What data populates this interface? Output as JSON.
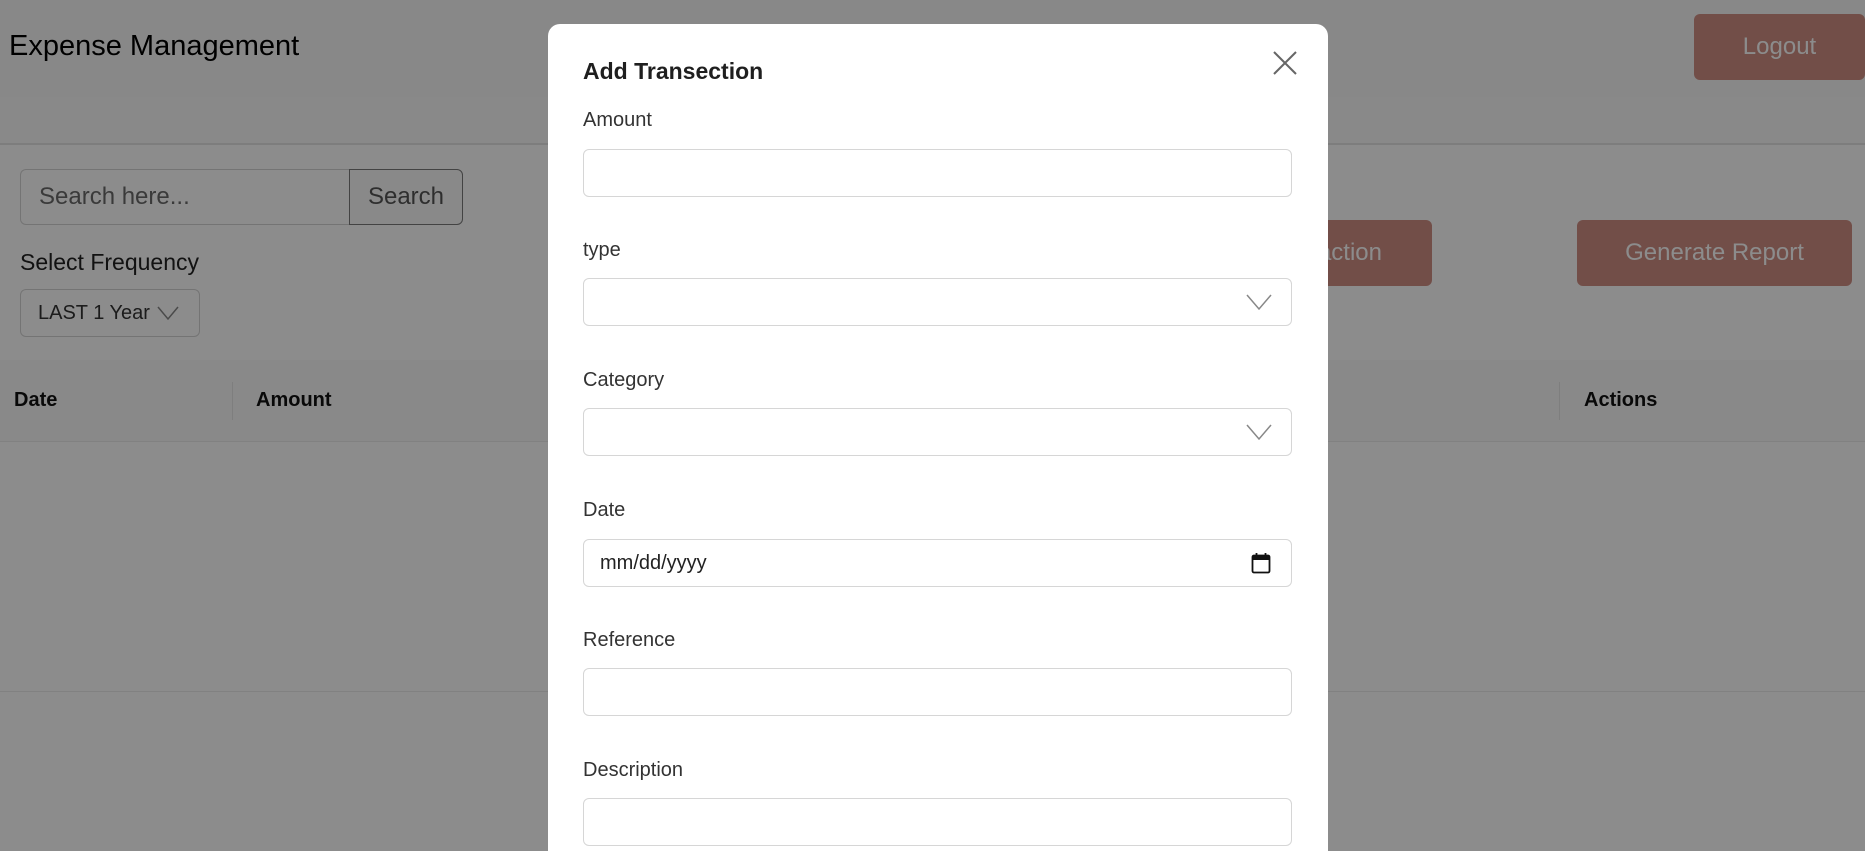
{
  "header": {
    "title": "Expense Management",
    "logout_label": "Logout"
  },
  "filters": {
    "search_placeholder": "Search here...",
    "search_button": "Search",
    "frequency_label": "Select Frequency",
    "frequency_value": "LAST 1 Year"
  },
  "actions": {
    "add_transaction_label": "action",
    "generate_report_label": "Generate Report"
  },
  "table": {
    "columns": [
      "Date",
      "Amount",
      "Actions"
    ]
  },
  "modal": {
    "title": "Add Transection",
    "fields": {
      "amount_label": "Amount",
      "type_label": "type",
      "category_label": "Category",
      "date_label": "Date",
      "date_placeholder": "mm/dd/yyyy",
      "reference_label": "Reference",
      "description_label": "Description"
    }
  },
  "colors": {
    "accent": "#cf8e83",
    "overlay": "rgba(0,0,0,0.45)"
  },
  "icons": {
    "close": "close-icon",
    "dropdown": "chevron-down-icon",
    "calendar": "calendar-icon"
  }
}
